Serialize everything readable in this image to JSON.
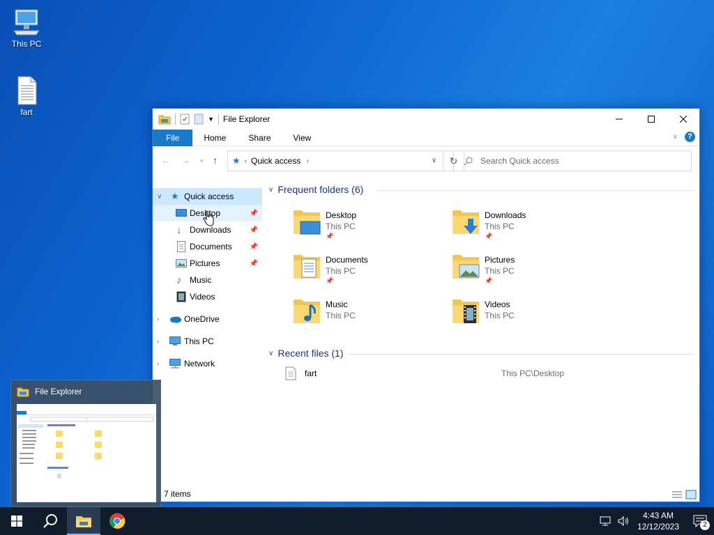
{
  "desktop": {
    "icons": [
      {
        "label": "This PC"
      },
      {
        "label": "fart"
      }
    ]
  },
  "window": {
    "title": "File Explorer",
    "ribbon_tabs": [
      "File",
      "Home",
      "Share",
      "View"
    ],
    "help_label": "?",
    "address_crumb": "Quick access",
    "search_placeholder": "Search Quick access",
    "status_text": "7 items"
  },
  "nav_pane": {
    "quick_access": "Quick access",
    "pinned": [
      {
        "label": "Desktop"
      },
      {
        "label": "Downloads"
      },
      {
        "label": "Documents"
      },
      {
        "label": "Pictures"
      },
      {
        "label": "Music"
      },
      {
        "label": "Videos"
      }
    ],
    "onedrive": "OneDrive",
    "this_pc": "This PC",
    "network": "Network"
  },
  "content": {
    "frequent_header": "Frequent folders (6)",
    "folders": [
      {
        "name": "Desktop",
        "location": "This PC",
        "icon": "desktop-folder-icon"
      },
      {
        "name": "Downloads",
        "location": "This PC",
        "icon": "downloads-folder-icon"
      },
      {
        "name": "Documents",
        "location": "This PC",
        "icon": "documents-folder-icon"
      },
      {
        "name": "Pictures",
        "location": "This PC",
        "icon": "pictures-folder-icon"
      },
      {
        "name": "Music",
        "location": "This PC",
        "icon": "music-folder-icon"
      },
      {
        "name": "Videos",
        "location": "This PC",
        "icon": "videos-folder-icon"
      }
    ],
    "recent_header": "Recent files (1)",
    "recent_files": [
      {
        "name": "fart",
        "path": "This PC\\Desktop"
      }
    ]
  },
  "preview": {
    "title": "File Explorer"
  },
  "taskbar": {
    "time": "4:43 AM",
    "date": "12/12/2023",
    "notification_count": "2"
  },
  "colors": {
    "accent": "#1979ca",
    "desktop": "#0d63cf",
    "taskbar": "#101b2b",
    "group_header": "#1e3287"
  }
}
